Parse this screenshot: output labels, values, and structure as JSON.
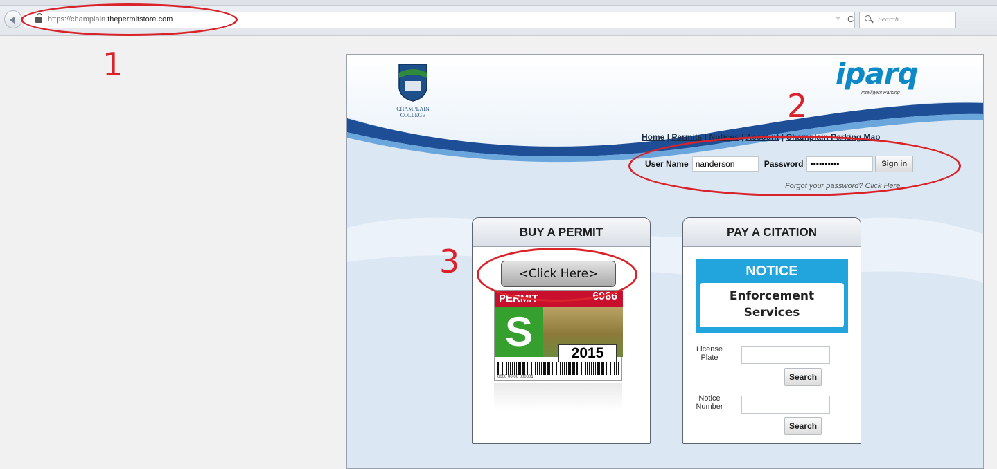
{
  "browser": {
    "url_prefix": "https://champlain.",
    "url_domain": "thepermitstore.com",
    "url_dropdown": "▿",
    "reload": "C",
    "search_placeholder": "Search"
  },
  "annotations": [
    "1",
    "2",
    "3"
  ],
  "site": {
    "logo_text_line1": "CHAMPLAIN",
    "logo_text_line2": "COLLEGE",
    "iparq_logo": "iparq",
    "iparq_tagline": "Intelligent Parking",
    "nav": {
      "home": "Home",
      "permits": "Permits",
      "notices": "Notices",
      "account": "Account",
      "map": "Champlain Parking Map",
      "separator": "|"
    },
    "login": {
      "username_label": "User Name",
      "username_value": "nanderson",
      "password_label": "Password",
      "password_value": "••••••••••",
      "signin_label": "Sign in",
      "forgot_text": "Forgot your password? Click Here"
    },
    "buy_permit": {
      "title": "BUY A PERMIT",
      "button_label": "<Click Here>",
      "permit_label": "PERMIT",
      "permit_number": "6986",
      "permit_letter": "S",
      "permit_year": "2015",
      "permit_serial": "0000 00 00 000001"
    },
    "pay_citation": {
      "title": "PAY A CITATION",
      "notice_title": "NOTICE",
      "notice_line1": "Enforcement",
      "notice_line2": "Services",
      "plate_label_1": "License",
      "plate_label_2": "Plate",
      "notice_label_1": "Notice",
      "notice_label_2": "Number",
      "search_label": "Search"
    }
  },
  "colors": {
    "annotation": "#d9222a",
    "wave_dark": "#1e4f96",
    "iparq": "#0c89c6",
    "notice_blue": "#22a4dc"
  }
}
